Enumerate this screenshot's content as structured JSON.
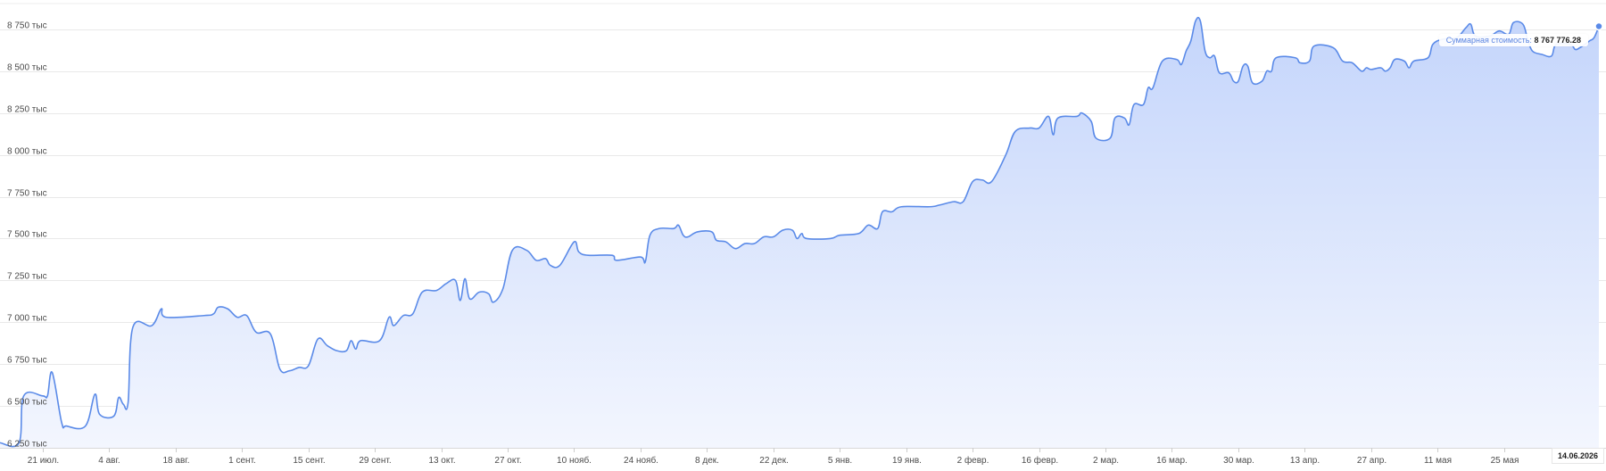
{
  "chart_data": {
    "type": "area",
    "title": "",
    "xlabel": "",
    "ylabel": "",
    "ylim": [
      6250,
      8925
    ],
    "yticks": [
      {
        "value": 6250,
        "label": "6 250 тыс"
      },
      {
        "value": 6500,
        "label": "6 500 тыс"
      },
      {
        "value": 6750,
        "label": "6 750 тыс"
      },
      {
        "value": 7000,
        "label": "7 000 тыс"
      },
      {
        "value": 7250,
        "label": "7 250 тыс"
      },
      {
        "value": 7500,
        "label": "7 500 тыс"
      },
      {
        "value": 7750,
        "label": "7 750 тыс"
      },
      {
        "value": 8000,
        "label": "8 000 тыс"
      },
      {
        "value": 8250,
        "label": "8 250 тыс"
      },
      {
        "value": 8500,
        "label": "8 500 тыс"
      },
      {
        "value": 8750,
        "label": "8 750 тыс"
      }
    ],
    "xlim": [
      "2025-07-12",
      "2026-06-14"
    ],
    "xticks": [
      {
        "date": "2025-07-21",
        "label": "21 июл."
      },
      {
        "date": "2025-08-04",
        "label": "4 авг."
      },
      {
        "date": "2025-08-18",
        "label": "18 авг."
      },
      {
        "date": "2025-09-01",
        "label": "1 сент."
      },
      {
        "date": "2025-09-15",
        "label": "15 сент."
      },
      {
        "date": "2025-09-29",
        "label": "29 сент."
      },
      {
        "date": "2025-10-13",
        "label": "13 окт."
      },
      {
        "date": "2025-10-27",
        "label": "27 окт."
      },
      {
        "date": "2025-11-10",
        "label": "10 нояб."
      },
      {
        "date": "2025-11-24",
        "label": "24 нояб."
      },
      {
        "date": "2025-12-08",
        "label": "8 дек."
      },
      {
        "date": "2025-12-22",
        "label": "22 дек."
      },
      {
        "date": "2026-01-05",
        "label": "5 янв."
      },
      {
        "date": "2026-01-19",
        "label": "19 янв."
      },
      {
        "date": "2026-02-02",
        "label": "2 февр."
      },
      {
        "date": "2026-02-16",
        "label": "16 февр."
      },
      {
        "date": "2026-03-02",
        "label": "2 мар."
      },
      {
        "date": "2026-03-16",
        "label": "16 мар."
      },
      {
        "date": "2026-03-30",
        "label": "30 мар."
      },
      {
        "date": "2026-04-13",
        "label": "13 апр."
      },
      {
        "date": "2026-04-27",
        "label": "27 апр."
      },
      {
        "date": "2026-05-11",
        "label": "11 мая"
      },
      {
        "date": "2026-05-25",
        "label": "25 мая"
      }
    ],
    "grid": true,
    "series": [
      {
        "color": "#5a8ae8",
        "fill_top": "#c4d5fb",
        "fill_bottom": "#f3f6fe",
        "points": [
          [
            "2025-07-12",
            6280
          ],
          [
            "2025-07-16",
            6280
          ],
          [
            "2025-07-17",
            6560
          ],
          [
            "2025-07-21",
            6560
          ],
          [
            "2025-07-22",
            6560
          ],
          [
            "2025-07-23",
            6700
          ],
          [
            "2025-07-25",
            6400
          ],
          [
            "2025-07-26",
            6380
          ],
          [
            "2025-07-30",
            6380
          ],
          [
            "2025-08-01",
            6570
          ],
          [
            "2025-08-02",
            6450
          ],
          [
            "2025-08-05",
            6440
          ],
          [
            "2025-08-06",
            6550
          ],
          [
            "2025-08-07",
            6510
          ],
          [
            "2025-08-08",
            6520
          ],
          [
            "2025-08-09",
            6970
          ],
          [
            "2025-08-13",
            6980
          ],
          [
            "2025-08-15",
            7080
          ],
          [
            "2025-08-16",
            7030
          ],
          [
            "2025-08-24",
            7040
          ],
          [
            "2025-08-26",
            7050
          ],
          [
            "2025-08-27",
            7090
          ],
          [
            "2025-08-29",
            7080
          ],
          [
            "2025-08-31",
            7030
          ],
          [
            "2025-09-02",
            7040
          ],
          [
            "2025-09-04",
            6940
          ],
          [
            "2025-09-07",
            6930
          ],
          [
            "2025-09-09",
            6720
          ],
          [
            "2025-09-11",
            6710
          ],
          [
            "2025-09-13",
            6730
          ],
          [
            "2025-09-15",
            6740
          ],
          [
            "2025-09-17",
            6900
          ],
          [
            "2025-09-19",
            6860
          ],
          [
            "2025-09-21",
            6830
          ],
          [
            "2025-09-23",
            6830
          ],
          [
            "2025-09-24",
            6890
          ],
          [
            "2025-09-25",
            6840
          ],
          [
            "2025-09-26",
            6890
          ],
          [
            "2025-09-30",
            6890
          ],
          [
            "2025-10-02",
            7030
          ],
          [
            "2025-10-03",
            6980
          ],
          [
            "2025-10-05",
            7040
          ],
          [
            "2025-10-07",
            7050
          ],
          [
            "2025-10-09",
            7180
          ],
          [
            "2025-10-12",
            7190
          ],
          [
            "2025-10-14",
            7230
          ],
          [
            "2025-10-16",
            7250
          ],
          [
            "2025-10-17",
            7130
          ],
          [
            "2025-10-18",
            7260
          ],
          [
            "2025-10-19",
            7140
          ],
          [
            "2025-10-21",
            7180
          ],
          [
            "2025-10-23",
            7170
          ],
          [
            "2025-10-24",
            7120
          ],
          [
            "2025-10-26",
            7200
          ],
          [
            "2025-10-28",
            7430
          ],
          [
            "2025-10-31",
            7430
          ],
          [
            "2025-11-02",
            7370
          ],
          [
            "2025-11-04",
            7380
          ],
          [
            "2025-11-05",
            7340
          ],
          [
            "2025-11-07",
            7340
          ],
          [
            "2025-11-10",
            7480
          ],
          [
            "2025-11-11",
            7420
          ],
          [
            "2025-11-13",
            7400
          ],
          [
            "2025-11-18",
            7400
          ],
          [
            "2025-11-19",
            7370
          ],
          [
            "2025-11-24",
            7390
          ],
          [
            "2025-11-25",
            7360
          ],
          [
            "2025-11-26",
            7520
          ],
          [
            "2025-11-28",
            7560
          ],
          [
            "2025-12-01",
            7560
          ],
          [
            "2025-12-02",
            7580
          ],
          [
            "2025-12-03",
            7520
          ],
          [
            "2025-12-04",
            7510
          ],
          [
            "2025-12-06",
            7540
          ],
          [
            "2025-12-09",
            7540
          ],
          [
            "2025-12-10",
            7490
          ],
          [
            "2025-12-12",
            7480
          ],
          [
            "2025-12-14",
            7440
          ],
          [
            "2025-12-16",
            7470
          ],
          [
            "2025-12-18",
            7470
          ],
          [
            "2025-12-20",
            7510
          ],
          [
            "2025-12-22",
            7510
          ],
          [
            "2025-12-24",
            7550
          ],
          [
            "2025-12-26",
            7550
          ],
          [
            "2025-12-27",
            7500
          ],
          [
            "2025-12-28",
            7530
          ],
          [
            "2025-12-29",
            7500
          ],
          [
            "2026-01-03",
            7500
          ],
          [
            "2026-01-05",
            7520
          ],
          [
            "2026-01-09",
            7530
          ],
          [
            "2026-01-11",
            7580
          ],
          [
            "2026-01-13",
            7560
          ],
          [
            "2026-01-14",
            7660
          ],
          [
            "2026-01-16",
            7660
          ],
          [
            "2026-01-18",
            7690
          ],
          [
            "2026-01-24",
            7690
          ],
          [
            "2026-01-26",
            7700
          ],
          [
            "2026-01-29",
            7720
          ],
          [
            "2026-01-31",
            7720
          ],
          [
            "2026-02-02",
            7840
          ],
          [
            "2026-02-04",
            7850
          ],
          [
            "2026-02-06",
            7840
          ],
          [
            "2026-02-09",
            8000
          ],
          [
            "2026-02-11",
            8140
          ],
          [
            "2026-02-14",
            8160
          ],
          [
            "2026-02-16",
            8160
          ],
          [
            "2026-02-18",
            8230
          ],
          [
            "2026-02-19",
            8120
          ],
          [
            "2026-02-20",
            8220
          ],
          [
            "2026-02-24",
            8230
          ],
          [
            "2026-02-25",
            8250
          ],
          [
            "2026-02-27",
            8200
          ],
          [
            "2026-02-28",
            8100
          ],
          [
            "2026-03-03",
            8100
          ],
          [
            "2026-03-04",
            8220
          ],
          [
            "2026-03-06",
            8220
          ],
          [
            "2026-03-07",
            8180
          ],
          [
            "2026-03-08",
            8300
          ],
          [
            "2026-03-10",
            8300
          ],
          [
            "2026-03-11",
            8400
          ],
          [
            "2026-03-12",
            8400
          ],
          [
            "2026-03-14",
            8560
          ],
          [
            "2026-03-17",
            8570
          ],
          [
            "2026-03-18",
            8540
          ],
          [
            "2026-03-19",
            8620
          ],
          [
            "2026-03-20",
            8680
          ],
          [
            "2026-03-21",
            8800
          ],
          [
            "2026-03-22",
            8800
          ],
          [
            "2026-03-23",
            8620
          ],
          [
            "2026-03-24",
            8580
          ],
          [
            "2026-03-25",
            8590
          ],
          [
            "2026-03-26",
            8490
          ],
          [
            "2026-03-28",
            8490
          ],
          [
            "2026-03-29",
            8440
          ],
          [
            "2026-03-30",
            8440
          ],
          [
            "2026-03-31",
            8530
          ],
          [
            "2026-04-01",
            8530
          ],
          [
            "2026-04-02",
            8430
          ],
          [
            "2026-04-04",
            8440
          ],
          [
            "2026-04-05",
            8500
          ],
          [
            "2026-04-06",
            8500
          ],
          [
            "2026-04-07",
            8580
          ],
          [
            "2026-04-11",
            8580
          ],
          [
            "2026-04-12",
            8550
          ],
          [
            "2026-04-14",
            8560
          ],
          [
            "2026-04-15",
            8650
          ],
          [
            "2026-04-19",
            8640
          ],
          [
            "2026-04-21",
            8560
          ],
          [
            "2026-04-23",
            8550
          ],
          [
            "2026-04-25",
            8500
          ],
          [
            "2026-04-26",
            8520
          ],
          [
            "2026-04-27",
            8510
          ],
          [
            "2026-04-29",
            8520
          ],
          [
            "2026-04-30",
            8500
          ],
          [
            "2026-05-01",
            8520
          ],
          [
            "2026-05-02",
            8570
          ],
          [
            "2026-05-04",
            8560
          ],
          [
            "2026-05-05",
            8520
          ],
          [
            "2026-05-06",
            8560
          ],
          [
            "2026-05-09",
            8580
          ],
          [
            "2026-05-10",
            8660
          ],
          [
            "2026-05-12",
            8690
          ],
          [
            "2026-05-15",
            8700
          ],
          [
            "2026-05-17",
            8760
          ],
          [
            "2026-05-18",
            8780
          ],
          [
            "2026-05-19",
            8710
          ],
          [
            "2026-05-22",
            8710
          ],
          [
            "2026-05-24",
            8740
          ],
          [
            "2026-05-26",
            8720
          ],
          [
            "2026-05-27",
            8790
          ],
          [
            "2026-05-29",
            8780
          ],
          [
            "2026-05-30",
            8690
          ],
          [
            "2026-05-31",
            8620
          ],
          [
            "2026-06-02",
            8600
          ],
          [
            "2026-06-04",
            8590
          ],
          [
            "2026-06-05",
            8660
          ],
          [
            "2026-06-08",
            8660
          ],
          [
            "2026-06-09",
            8630
          ],
          [
            "2026-06-10",
            8640
          ],
          [
            "2026-06-12",
            8680
          ],
          [
            "2026-06-13",
            8700
          ],
          [
            "2026-06-14",
            8767.78
          ]
        ]
      }
    ],
    "tooltip": {
      "label": "Суммарная стоимость:",
      "value": "8 767 776.28"
    },
    "date_badge": "14.06.2026"
  }
}
